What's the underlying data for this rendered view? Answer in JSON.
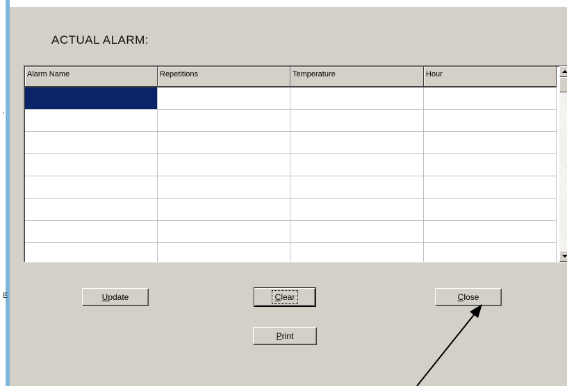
{
  "page": {
    "title": "ACTUAL ALARM:"
  },
  "grid": {
    "columns": [
      "Alarm Name",
      "Repetitions",
      "Temperature",
      "Hour"
    ],
    "row_count": 8,
    "selected_row": 0,
    "selected_col": 0
  },
  "buttons": {
    "update": {
      "prefix": "",
      "accel": "U",
      "rest": "pdate"
    },
    "clear": {
      "prefix": "",
      "accel": "C",
      "rest": "lear"
    },
    "close": {
      "prefix": "",
      "accel": "C",
      "rest": "lose"
    },
    "print": {
      "prefix": "",
      "accel": "P",
      "rest": "rint"
    }
  },
  "edge_glyphs": {
    "top": "'",
    "mid": "E"
  },
  "colors": {
    "window_bg": "#d4d0c8",
    "selection": "#0a246a",
    "left_rule": "#7fb6db"
  }
}
